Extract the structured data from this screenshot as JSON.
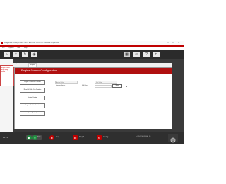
{
  "window": {
    "title": "Diagnostic Configuration Tool - ENGINE CONFIG - Service Application",
    "min": "—",
    "max": "□",
    "close": "✕"
  },
  "redbar": {
    "text": "Connection: ECU   Status: Online"
  },
  "menu": [
    "File",
    "Options",
    "Tools",
    "Help"
  ],
  "toolbar": {
    "left_icons": [
      "home-icon",
      "upload-icon",
      "refresh-icon",
      "camera-icon"
    ],
    "right_icons": [
      "keyboard-icon",
      "window-icon",
      "help-icon",
      "close-icon"
    ],
    "left_glyphs": [
      "⌂",
      "⇪",
      "↻",
      "◉"
    ],
    "right_glyphs": [
      "▦",
      "▭",
      "?",
      "✕"
    ]
  },
  "left_panel": {
    "lines": [
      "Engine Crankc.",
      "Eng Config",
      "Status"
    ]
  },
  "dialog_tabs": [
    "Overview",
    "Engine"
  ],
  "dialog": {
    "title": "Engine Crankc Configuration",
    "side_buttons": [
      "Engine Crankcase Control",
      "Read Oil Filler Cap Position",
      "Engine Control",
      "Engine Crankc Counter",
      "Cancel Actuals"
    ],
    "field_header_left": "Actual Value",
    "field_header_right": "Set Value",
    "field_label": "Engine Hours",
    "field_unit": "000 Hrs",
    "field_value": "",
    "field_button": "Write",
    "status_indicator": "●"
  },
  "statusbar": {
    "version": "v.3.0.0",
    "btn1_label": "Start",
    "btn2_label": "Stop",
    "btn3_label": "Step 4",
    "btn4_label": "Config",
    "id_text": "A_EDC_MD1_EM_10",
    "brand": "Logo"
  }
}
